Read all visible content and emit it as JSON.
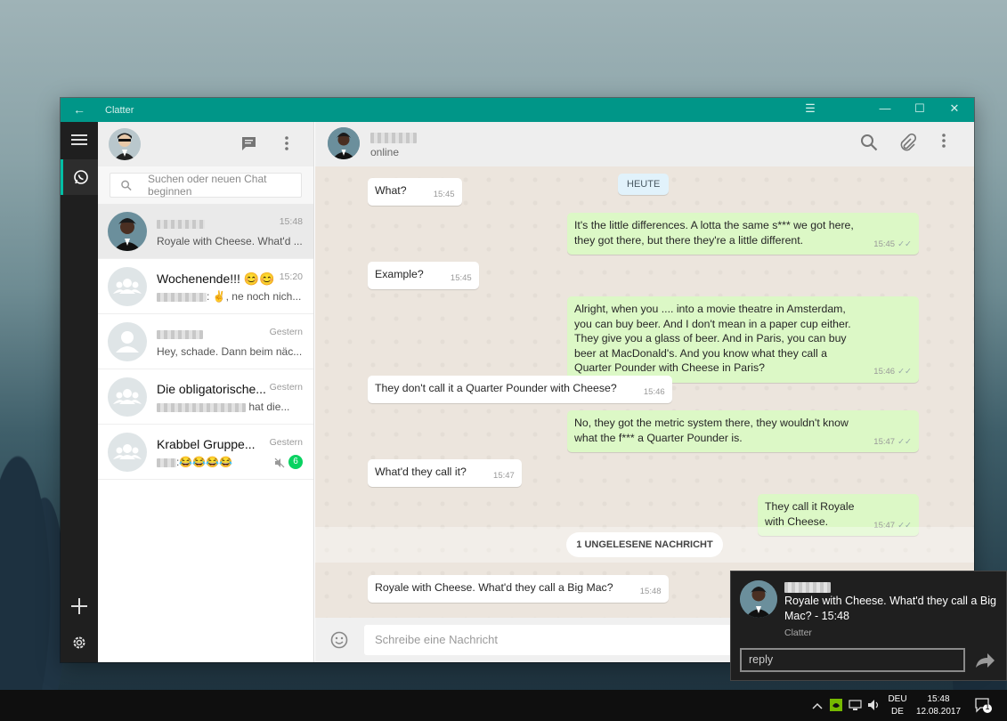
{
  "window": {
    "title": "Clatter"
  },
  "search": {
    "placeholder": "Suchen oder neuen Chat beginnen"
  },
  "chats": [
    {
      "name": "",
      "time": "15:48",
      "preview": "Royale with Cheese. What'd ..."
    },
    {
      "name": "Wochenende!!! 😊😊",
      "time": "15:20",
      "preview": "✌, ne noch nich..."
    },
    {
      "name": "",
      "time": "Gestern",
      "preview": "Hey, schade. Dann beim näc..."
    },
    {
      "name": "Die obligatorische...",
      "time": "Gestern",
      "preview": "hat die..."
    },
    {
      "name": "Krabbel Gruppe...",
      "time": "Gestern",
      "preview": ":😂😂😂😂",
      "unread": "6"
    }
  ],
  "conversation": {
    "status": "online",
    "day_label": "HEUTE",
    "unread_label": "1 UNGELESENE NACHRICHT",
    "composer_placeholder": "Schreibe eine Nachricht",
    "messages": [
      {
        "dir": "in",
        "text": "What?",
        "time": "15:45"
      },
      {
        "dir": "out",
        "text": "It's the little differences. A lotta the same s*** we got here, they got there, but there they're a little different.",
        "time": "15:45"
      },
      {
        "dir": "in",
        "text": "Example?",
        "time": "15:45"
      },
      {
        "dir": "out",
        "text": "Alright, when you .... into a movie theatre in Amsterdam, you can buy beer. And I don't mean in a paper cup either. They give you a glass of beer. And in Paris, you can buy beer at MacDonald's. And you know what they call a Quarter Pounder with Cheese in Paris?",
        "time": "15:46"
      },
      {
        "dir": "in",
        "text": "They don't call it a Quarter Pounder with Cheese?",
        "time": "15:46"
      },
      {
        "dir": "out",
        "text": "No, they got the metric system there, they wouldn't know what the f*** a Quarter Pounder is.",
        "time": "15:47"
      },
      {
        "dir": "in",
        "text": "What'd they call it?",
        "time": "15:47"
      },
      {
        "dir": "out",
        "text": "They call it Royale with Cheese.",
        "time": "15:47"
      },
      {
        "dir": "in",
        "text": "Royale with Cheese. What'd they call a Big Mac?",
        "time": "15:48"
      }
    ]
  },
  "toast": {
    "message": "Royale with Cheese. What'd they call a Big Mac? - 15:48",
    "app": "Clatter",
    "reply_placeholder": "reply"
  },
  "taskbar": {
    "lang1": "DEU",
    "lang2": "DE",
    "time": "15:48",
    "date": "12.08.2017",
    "notifications": "1"
  },
  "colors": {
    "accent": "#009688",
    "outgoing": "#dcf8c6",
    "unread_badge": "#09d261"
  }
}
